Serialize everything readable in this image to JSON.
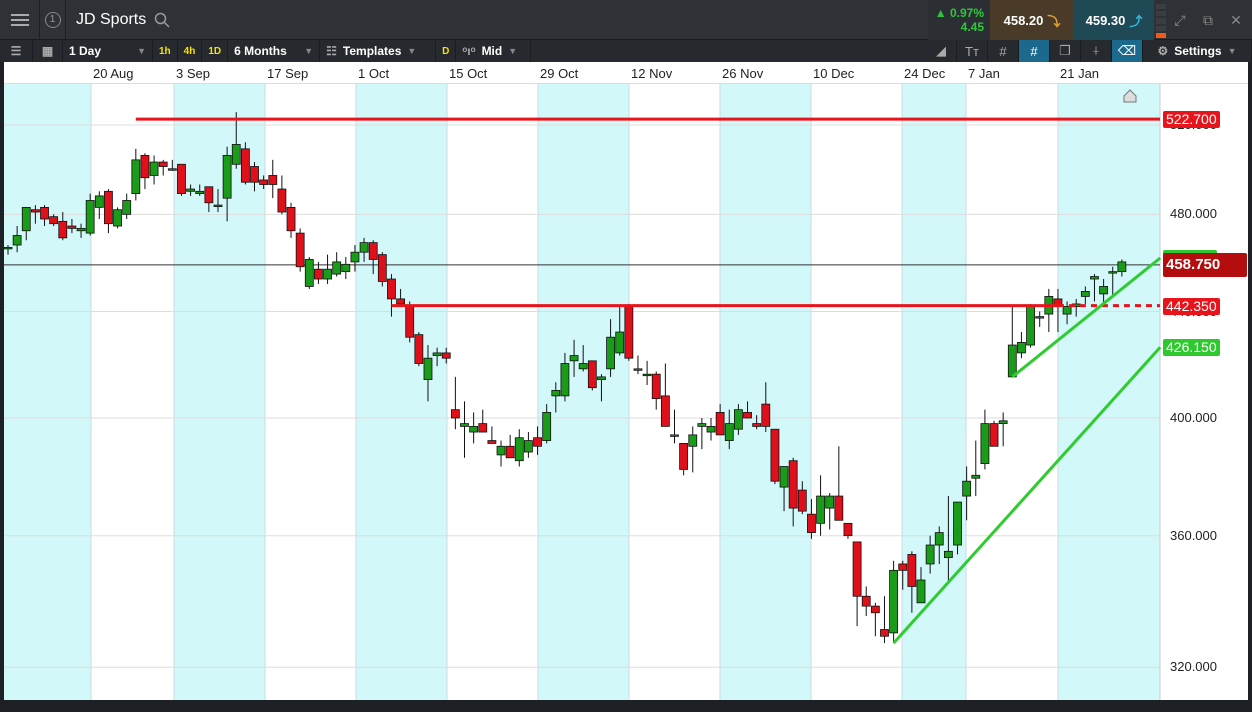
{
  "header": {
    "instrument": "JD Sports",
    "window_number": "1",
    "change_pct": "0.97%",
    "change_abs": "4.45",
    "sell_price": "458.20",
    "buy_price": "459.30"
  },
  "toolbar": {
    "interval": "1 Day",
    "quick_intervals": [
      "1h",
      "4h",
      "1D"
    ],
    "range": "6 Months",
    "templates": "Templates",
    "d_badge": "D",
    "price_type": "Mid",
    "settings": "Settings"
  },
  "date_axis": [
    "20 Aug",
    "3 Sep",
    "17 Sep",
    "1 Oct",
    "15 Oct",
    "29 Oct",
    "12 Nov",
    "26 Nov",
    "10 Dec",
    "24 Dec",
    "7 Jan",
    "21 Jan"
  ],
  "price_axis": [
    "520.000",
    "480.000",
    "440.000",
    "400.000",
    "360.000",
    "320.000"
  ],
  "tags": {
    "resistance": "522.700",
    "current": "458.750",
    "support": "442.350",
    "trend": "426.150"
  },
  "colors": {
    "up": "#1a9b1a",
    "down": "#e0101a",
    "line_red": "#e8141c",
    "line_green": "#2ecc2e",
    "band": "#d2f8fa"
  },
  "chart_data": {
    "type": "candlestick",
    "scale": "log",
    "ylim": [
      312,
      532
    ],
    "levels": [
      {
        "price": 522.7,
        "from_index": 14
      },
      {
        "price": 442.35,
        "from_index": 42,
        "dashed_from_index": 115
      },
      {
        "price": 458.75,
        "kind": "last"
      }
    ],
    "trendlines": [
      {
        "from": [
          97,
          327
        ],
        "to": [
          126.2,
          426.15
        ]
      },
      {
        "from": [
          110,
          415
        ],
        "to": [
          126.2,
          461.6
        ]
      }
    ],
    "candles": [
      [
        466,
        467,
        463,
        466
      ],
      [
        467,
        475,
        464,
        471
      ],
      [
        473,
        483,
        469,
        483
      ],
      [
        482,
        484,
        476,
        481
      ],
      [
        483,
        484,
        475,
        478
      ],
      [
        479,
        480,
        475,
        476
      ],
      [
        477,
        481,
        469,
        470
      ],
      [
        475,
        478,
        472,
        474
      ],
      [
        473,
        476,
        470,
        474
      ],
      [
        472,
        489,
        471,
        486
      ],
      [
        483,
        490,
        478,
        488
      ],
      [
        490,
        491,
        472,
        476
      ],
      [
        475,
        483,
        474,
        482
      ],
      [
        480,
        489,
        478,
        486
      ],
      [
        489,
        509,
        486,
        504
      ],
      [
        506,
        507,
        491,
        496
      ],
      [
        497,
        506,
        493,
        503
      ],
      [
        503,
        504,
        497,
        501
      ],
      [
        500,
        504,
        499,
        500
      ],
      [
        502,
        502,
        488,
        489
      ],
      [
        490,
        493,
        488,
        491
      ],
      [
        489,
        493,
        488,
        490
      ],
      [
        492,
        492,
        481,
        485
      ],
      [
        484,
        491,
        481,
        484
      ],
      [
        487,
        510,
        477,
        506
      ],
      [
        502,
        526,
        500,
        511
      ],
      [
        509,
        512,
        493,
        494
      ],
      [
        501,
        503,
        490,
        494
      ],
      [
        495,
        497,
        491,
        493
      ],
      [
        497,
        504,
        487,
        493
      ],
      [
        491,
        497,
        480,
        481
      ],
      [
        483,
        485,
        470,
        473
      ],
      [
        472,
        474,
        456,
        458
      ],
      [
        450,
        462,
        449,
        461
      ],
      [
        457,
        460,
        451,
        453
      ],
      [
        453,
        463,
        451,
        457
      ],
      [
        455,
        464,
        454,
        460
      ],
      [
        456,
        462,
        453,
        459
      ],
      [
        460,
        467,
        456,
        464
      ],
      [
        464,
        470,
        460,
        468
      ],
      [
        468,
        469,
        455,
        461
      ],
      [
        463,
        464,
        450,
        452
      ],
      [
        453,
        455,
        438,
        445
      ],
      [
        445,
        449,
        442,
        443
      ],
      [
        442,
        444,
        428,
        430
      ],
      [
        431,
        432,
        419,
        420
      ],
      [
        414,
        427,
        406,
        422
      ],
      [
        423,
        426,
        419,
        424
      ],
      [
        424,
        426,
        420,
        422
      ],
      [
        403,
        415,
        396,
        400
      ],
      [
        397,
        406,
        386,
        398
      ],
      [
        395,
        402,
        391,
        397
      ],
      [
        398,
        403,
        395,
        395
      ],
      [
        392,
        397,
        391,
        391
      ],
      [
        387,
        392,
        383,
        390
      ],
      [
        390,
        394,
        386,
        386
      ],
      [
        385,
        396,
        383,
        393
      ],
      [
        388,
        395,
        386,
        392
      ],
      [
        393,
        397,
        387,
        390
      ],
      [
        392,
        405,
        391,
        402
      ],
      [
        408,
        413,
        402,
        410
      ],
      [
        408,
        424,
        406,
        420
      ],
      [
        421,
        429,
        415,
        423
      ],
      [
        418,
        427,
        417,
        420
      ],
      [
        421,
        421,
        410,
        411
      ],
      [
        414,
        416,
        406,
        415
      ],
      [
        418,
        437,
        415,
        430
      ],
      [
        424,
        442,
        423,
        432
      ],
      [
        442,
        443,
        421,
        422
      ],
      [
        418,
        423,
        416,
        418
      ],
      [
        416,
        421,
        412,
        416
      ],
      [
        416,
        417,
        403,
        407
      ],
      [
        408,
        420,
        397,
        397
      ],
      [
        394,
        403,
        391,
        394
      ],
      [
        391,
        391,
        380,
        382
      ],
      [
        390,
        397,
        381,
        394
      ],
      [
        397,
        400,
        389,
        398
      ],
      [
        395,
        400,
        392,
        397
      ],
      [
        402,
        405,
        394,
        394
      ],
      [
        392,
        403,
        389,
        398
      ],
      [
        396,
        405,
        394,
        403
      ],
      [
        402,
        406,
        400,
        400
      ],
      [
        398,
        401,
        396,
        397
      ],
      [
        405,
        413,
        395,
        397
      ],
      [
        396,
        396,
        377,
        378
      ],
      [
        376,
        383,
        368,
        383
      ],
      [
        385,
        386,
        363,
        369
      ],
      [
        375,
        378,
        367,
        368
      ],
      [
        367,
        372,
        359,
        361
      ],
      [
        364,
        380,
        360,
        373
      ],
      [
        369,
        374,
        362,
        373
      ],
      [
        373,
        390,
        365,
        365
      ],
      [
        364,
        364,
        359,
        360
      ],
      [
        358,
        358,
        332,
        341
      ],
      [
        341,
        344,
        335,
        338
      ],
      [
        338,
        339,
        329,
        336
      ],
      [
        331,
        341,
        327,
        329
      ],
      [
        330,
        352,
        327,
        349
      ],
      [
        351,
        352,
        343,
        349
      ],
      [
        354,
        355,
        336,
        344
      ],
      [
        339,
        350,
        339,
        346
      ],
      [
        351,
        360,
        348,
        357
      ],
      [
        357,
        363,
        351,
        361
      ],
      [
        353,
        373,
        345,
        355
      ],
      [
        357,
        370,
        354,
        371
      ],
      [
        373,
        383,
        365,
        378
      ],
      [
        379,
        392,
        373,
        380
      ],
      [
        384,
        403,
        382,
        398
      ],
      [
        398,
        399,
        390,
        390
      ],
      [
        398,
        402,
        390,
        399
      ],
      [
        415,
        442,
        415,
        427
      ],
      [
        424,
        432,
        422,
        428
      ],
      [
        427,
        443,
        426,
        442
      ],
      [
        438,
        440,
        434,
        438
      ],
      [
        439,
        449,
        432,
        446
      ],
      [
        445,
        449,
        432,
        442
      ],
      [
        439,
        444,
        435,
        442
      ],
      [
        442,
        445,
        438,
        443
      ],
      [
        446,
        450,
        443,
        448
      ],
      [
        453,
        455,
        444,
        454
      ],
      [
        447,
        453,
        443,
        450
      ],
      [
        456,
        458,
        446,
        456
      ],
      [
        456,
        461,
        454,
        460
      ]
    ]
  }
}
